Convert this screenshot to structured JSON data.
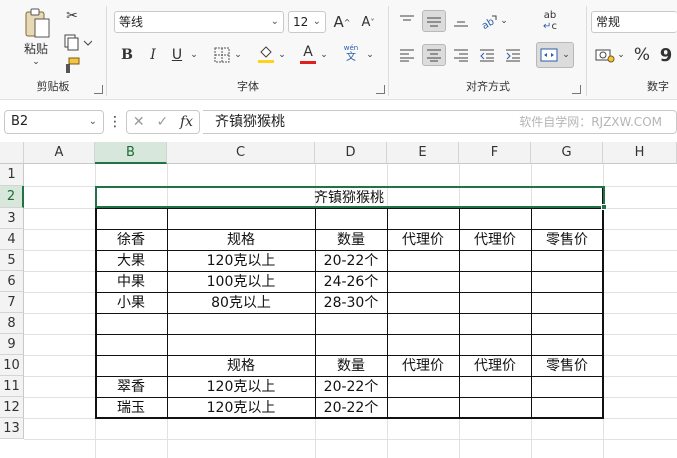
{
  "ribbon": {
    "clipboard": {
      "paste_label": "粘贴",
      "group_label": "剪贴板"
    },
    "font": {
      "name": "等线",
      "size": "12",
      "bold": "B",
      "italic": "I",
      "underline": "U",
      "increase": "A^",
      "decrease": "A˅",
      "font_color": "A",
      "phonetic_top": "wén",
      "phonetic_bottom": "文",
      "group_label": "字体"
    },
    "alignment": {
      "group_label": "对齐方式",
      "wrap_label": "ab",
      "wrap_label2": "c"
    },
    "number": {
      "format": "常规",
      "percent": "%",
      "comma": "9",
      "group_label": "数字"
    }
  },
  "formula_bar": {
    "name_box": "B2",
    "fx": "fx",
    "content": "齐镇猕猴桃",
    "watermark": "软件自学网：RJZXW.COM"
  },
  "grid": {
    "columns": [
      "A",
      "B",
      "C",
      "D",
      "E",
      "F",
      "G",
      "H"
    ],
    "rows": [
      "1",
      "2",
      "3",
      "4",
      "5",
      "6",
      "7",
      "8",
      "9",
      "10",
      "11",
      "12",
      "13"
    ],
    "selected_cell": "B2",
    "cells": {
      "title": "齐镇猕猴桃",
      "r4": [
        "徐香",
        "规格",
        "数量",
        "代理价",
        "代理价",
        "零售价"
      ],
      "r5": [
        "大果",
        "120克以上",
        "20-22个"
      ],
      "r6": [
        "中果",
        "100克以上",
        "24-26个"
      ],
      "r7": [
        "小果",
        "80克以上",
        "28-30个"
      ],
      "r10": [
        "",
        "规格",
        "数量",
        "代理价",
        "代理价",
        "零售价"
      ],
      "r11": [
        "翠香",
        "120克以上",
        "20-22个"
      ],
      "r12": [
        "瑞玉",
        "120克以上",
        "20-22个"
      ]
    }
  },
  "colors": {
    "accent": "#217346",
    "font_color_bar": "#e02020",
    "highlight_bar": "#ffd21c"
  }
}
